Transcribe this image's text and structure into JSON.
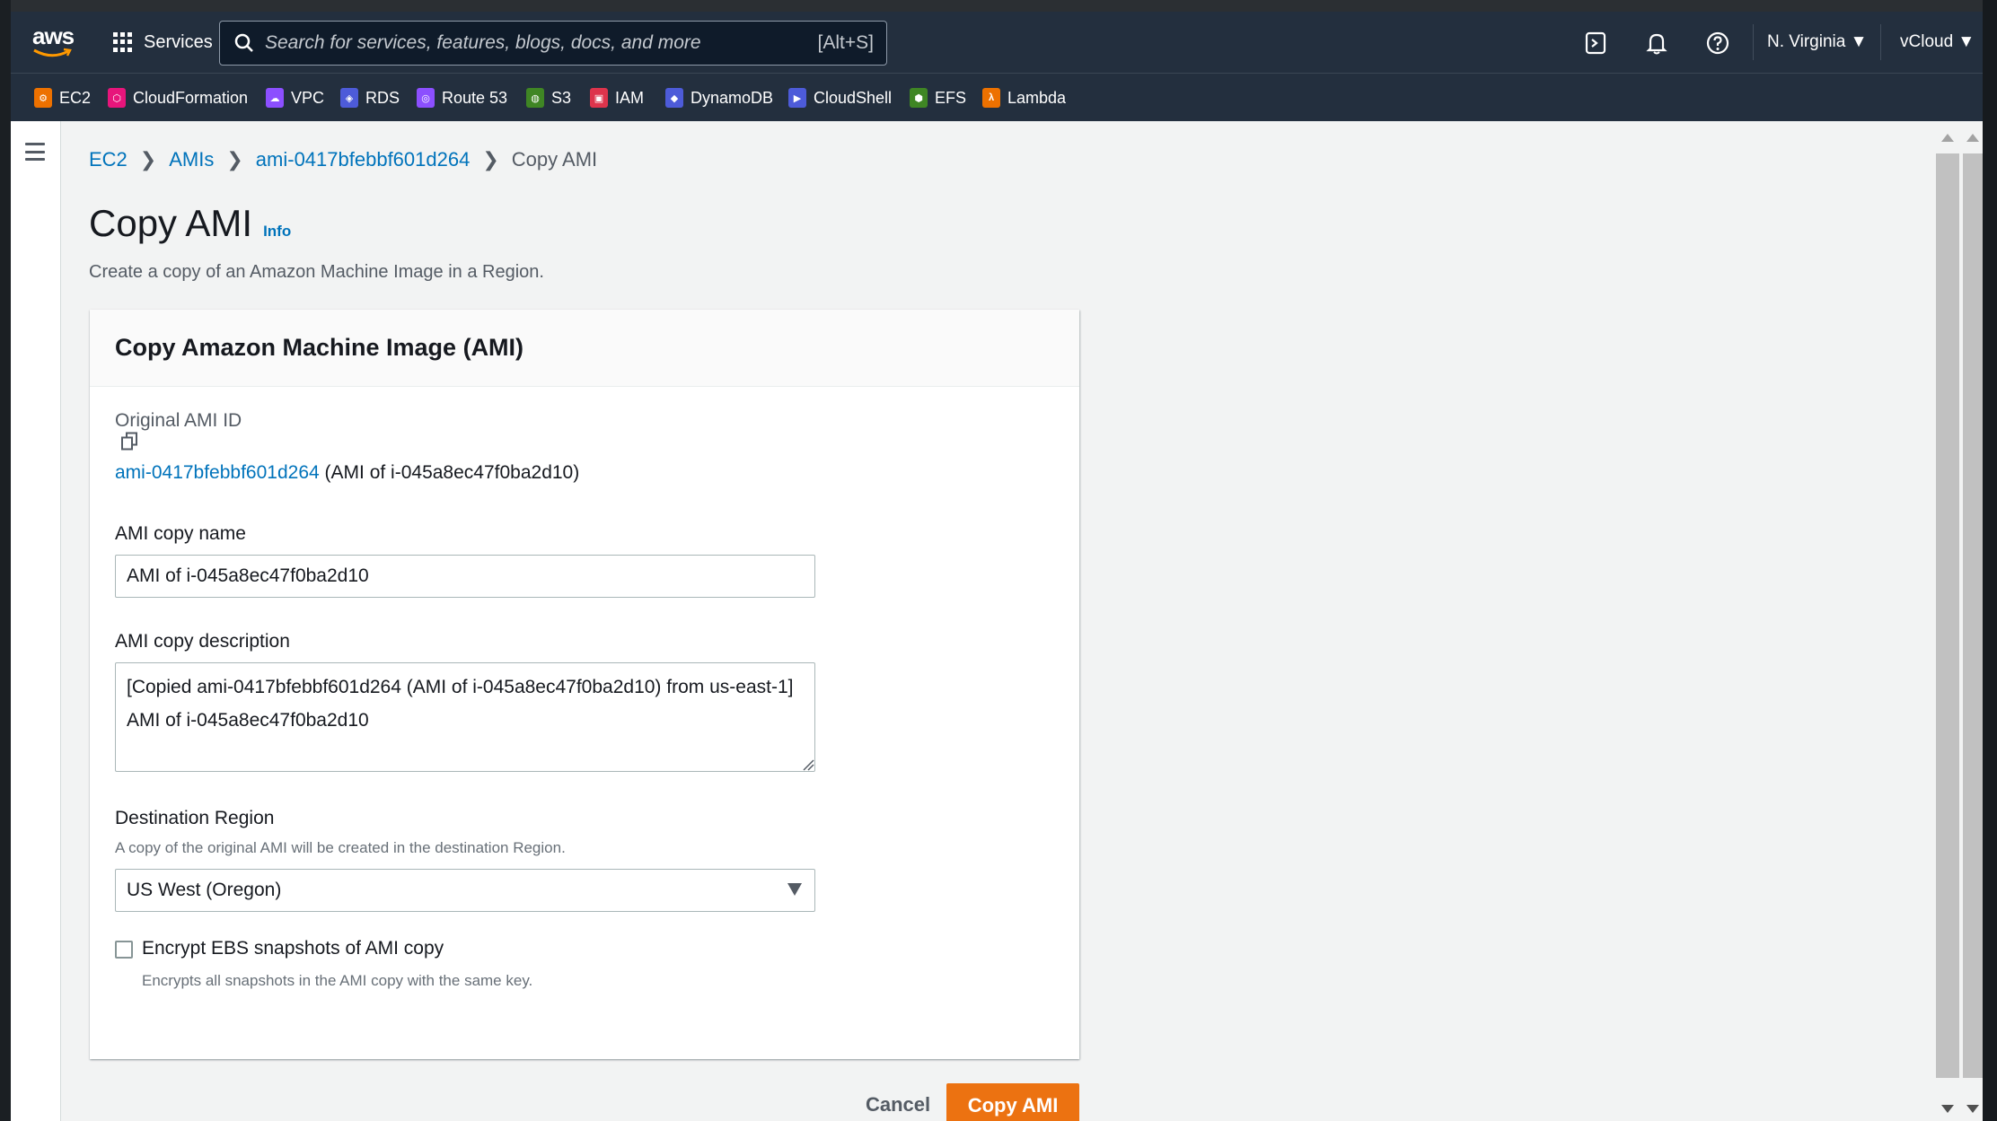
{
  "topnav": {
    "logo": "aws",
    "services_label": "Services",
    "search_placeholder": "Search for services, features, blogs, docs, and more",
    "search_shortcut": "[Alt+S]",
    "region": "N. Virginia ▼",
    "account": "vCloud ▼"
  },
  "favorites": [
    {
      "label": "EC2",
      "color": "#ed7100"
    },
    {
      "label": "CloudFormation",
      "color": "#e7157b"
    },
    {
      "label": "VPC",
      "color": "#8c4fff"
    },
    {
      "label": "RDS",
      "color": "#4d5bd9"
    },
    {
      "label": "Route 53",
      "color": "#8c4fff"
    },
    {
      "label": "S3",
      "color": "#3f8624"
    },
    {
      "label": "IAM",
      "color": "#dd344c"
    },
    {
      "label": "DynamoDB",
      "color": "#4d5bd9"
    },
    {
      "label": "CloudShell",
      "color": "#4d5bd9"
    },
    {
      "label": "EFS",
      "color": "#3f8624"
    },
    {
      "label": "Lambda",
      "color": "#ed7100"
    }
  ],
  "breadcrumb": {
    "items": [
      "EC2",
      "AMIs",
      "ami-0417bfebbf601d264"
    ],
    "current": "Copy AMI"
  },
  "page": {
    "title": "Copy AMI",
    "info": "Info",
    "description": "Create a copy of an Amazon Machine Image in a Region."
  },
  "panel": {
    "title": "Copy Amazon Machine Image (AMI)",
    "original_label": "Original AMI ID",
    "original_id": "ami-0417bfebbf601d264",
    "original_suffix": "(AMI of i-045a8ec47f0ba2d10)",
    "name_label": "AMI copy name",
    "name_value": "AMI of i-045a8ec47f0ba2d10",
    "desc_label": "AMI copy description",
    "desc_value": "[Copied ami-0417bfebbf601d264 (AMI of i-045a8ec47f0ba2d10) from us-east-1] AMI of i-045a8ec47f0ba2d10",
    "region_label": "Destination Region",
    "region_hint": "A copy of the original AMI will be created in the destination Region.",
    "region_value": "US West (Oregon)",
    "encrypt_label": "Encrypt EBS snapshots of AMI copy",
    "encrypt_hint": "Encrypts all snapshots in the AMI copy with the same key.",
    "encrypt_checked": false
  },
  "actions": {
    "cancel": "Cancel",
    "submit": "Copy AMI"
  }
}
